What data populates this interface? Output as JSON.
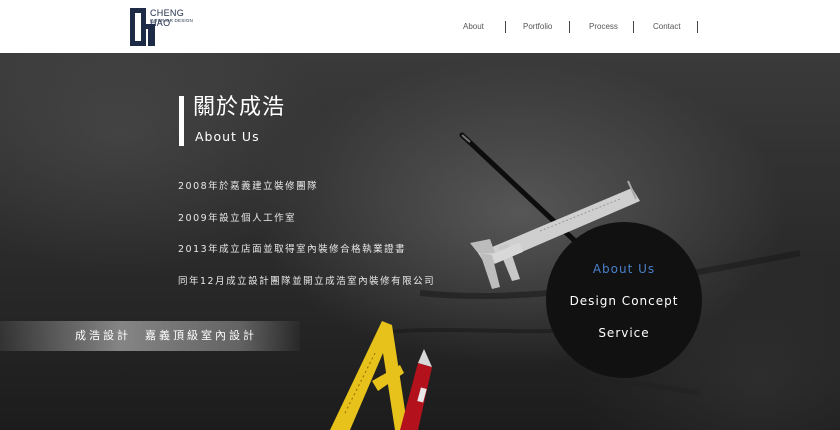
{
  "logo": {
    "name": "CHENG HAO",
    "subtitle": "INTERIOR DESIGN"
  },
  "nav": {
    "items": [
      "About",
      "Portfolio",
      "Process",
      "Contact"
    ]
  },
  "about": {
    "title_zh": "關於成浩",
    "title_en": "About Us",
    "history": [
      "2008年於嘉義建立裝修團隊",
      "2009年設立個人工作室",
      "2013年成立店面並取得室內裝修合格執業證書",
      "同年12月成立設計團隊並開立成浩室內裝修有限公司"
    ],
    "slogan": "成浩設計　嘉義頂級室內設計"
  },
  "circle_menu": {
    "items": [
      "About Us",
      "Design Concept",
      "Service"
    ],
    "active_color": "#4a7fc9",
    "color": "#ffffff"
  },
  "colors": {
    "brand": "#1e2b47",
    "header_bg": "#ffffff"
  }
}
